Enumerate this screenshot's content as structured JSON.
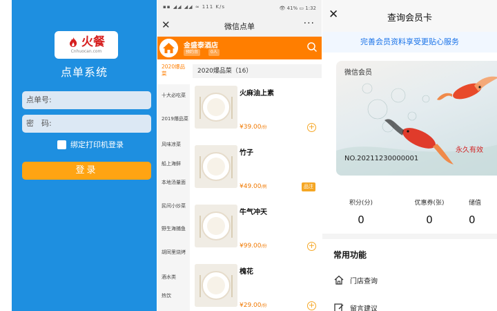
{
  "login": {
    "logo_text": "火餐",
    "logo_sub": "Cnhuocan.com",
    "system_title": "点单系统",
    "order_no_placeholder": "点单号:",
    "password_placeholder": "密　码:",
    "bind_printer_label": "绑定打印机登录",
    "login_button": "登录",
    "colors": {
      "bg": "#1e8fe0",
      "button": "#ffa413"
    }
  },
  "order": {
    "status_left": "▪▪ ◢◢ ◢◢ ≈ 111 K/s",
    "status_right": "👁 41% ▭ 1:32",
    "close_icon": "close-icon",
    "title": "微信点单",
    "more": "···",
    "store_name": "金盛泰酒店",
    "store_chip_reserve": "预约台",
    "store_chip_people": "0人",
    "accent": "#ff7e00",
    "categories": [
      {
        "label": "2020爆品菜",
        "active": true
      },
      {
        "label": "十大必吃菜"
      },
      {
        "label": "2019爆品菜"
      },
      {
        "label": "风味凉菜"
      },
      {
        "label": "船上海鲜"
      },
      {
        "label": "本地汤量面"
      },
      {
        "label": "民间小炒菜"
      },
      {
        "label": "野生海捕鱼"
      },
      {
        "label": "胡同里烧烤"
      },
      {
        "label": "酒水类"
      },
      {
        "label": "热饮"
      }
    ],
    "category_header": "2020爆品菜（16）",
    "dishes": [
      {
        "name": "火麻油上素",
        "price": "¥39.00",
        "unit": "/份",
        "action": "+"
      },
      {
        "name": "竹子",
        "price": "¥49.00",
        "unit": "/例",
        "action": "品注"
      },
      {
        "name": "牛气冲天",
        "price": "¥99.00",
        "unit": "/份",
        "action": "+"
      },
      {
        "name": "槐花",
        "price": "¥29.00",
        "unit": "/份",
        "action": "+"
      }
    ]
  },
  "member": {
    "title": "查询会员卡",
    "banner": "完善会员资料享受更贴心服务",
    "card_label": "微信会员",
    "card_no": "NO.20211230000001",
    "card_valid": "永久有效",
    "stats": [
      {
        "label": "积分(分)",
        "value": "0"
      },
      {
        "label": "优惠券(张)",
        "value": "0"
      },
      {
        "label": "储值",
        "value": "0"
      }
    ],
    "section_title": "常用功能",
    "functions": [
      {
        "label": "门店查询",
        "icon": "home-icon"
      },
      {
        "label": "留言建议",
        "icon": "edit-icon"
      }
    ],
    "banner_color": "#1a73e8"
  }
}
